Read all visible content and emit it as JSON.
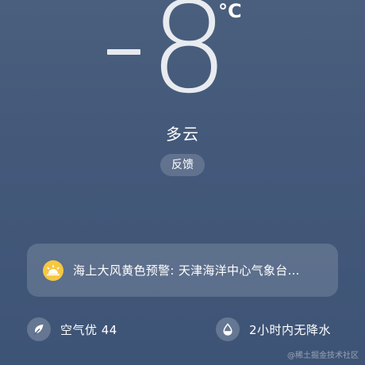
{
  "weather": {
    "temperature_sign": "-",
    "temperature_value": "8",
    "temperature_unit": "°C",
    "condition": "多云",
    "feedback_label": "反馈"
  },
  "alert": {
    "icon": "sunrise-warning-icon",
    "icon_color": "#f5c842",
    "text": "海上大风黄色预警: 天津海洋中心气象台…"
  },
  "air_quality": {
    "icon": "leaf-icon",
    "text": "空气优 44"
  },
  "precipitation": {
    "icon": "water-drop-icon",
    "text": "2小时内无降水"
  },
  "watermark": "@稀土掘金技术社区"
}
